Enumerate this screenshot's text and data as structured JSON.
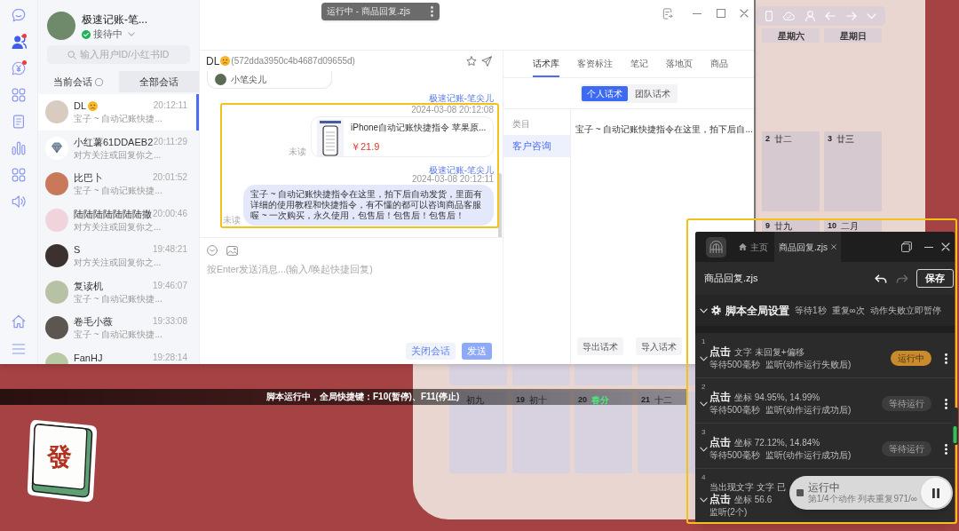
{
  "top_pill": {
    "title": "运行中 - 商品回复.zjs"
  },
  "chat_window": {
    "nav": [
      {
        "kind": "chat",
        "selected": false,
        "badge": false
      },
      {
        "kind": "customers",
        "selected": true,
        "badge": true
      },
      {
        "kind": "yen_chat",
        "selected": false,
        "badge": true
      },
      {
        "kind": "apps",
        "selected": false,
        "badge": false
      },
      {
        "kind": "document",
        "selected": false,
        "badge": false
      },
      {
        "kind": "stats",
        "selected": false,
        "badge": false
      },
      {
        "kind": "apps",
        "selected": false,
        "badge": false
      },
      {
        "kind": "sound",
        "selected": false,
        "badge": false
      }
    ],
    "nav_bottom": [
      {
        "kind": "home"
      },
      {
        "kind": "menu"
      }
    ],
    "account": {
      "name": "极速记账-笔...",
      "status": "接待中",
      "online": true
    },
    "search": {
      "placeholder": "输入用户ID/小红书ID"
    },
    "session_tabs": [
      {
        "label": "当前会话",
        "selected": true,
        "ring": true
      },
      {
        "label": "全部会话",
        "selected": false,
        "ring": false
      }
    ],
    "conversations": [
      {
        "name": "DL",
        "emoji": true,
        "avatar": {
          "kind": "photo"
        },
        "preview": "宝子 ~ 自动记账快捷...",
        "time": "20:12:11",
        "selected": true
      },
      {
        "name": "小红薯61DDAEB2",
        "emoji": false,
        "avatar": {
          "kind": "diamond"
        },
        "preview": "对方关注或回复你之...",
        "time": "20:11:29",
        "selected": false
      },
      {
        "name": "比巴卜",
        "emoji": false,
        "avatar": {
          "kind": "photo"
        },
        "preview": "宝子 ~ 自动记账快捷...",
        "time": "20:01:52",
        "selected": false
      },
      {
        "name": "陆陆陆陆陆陆陆撒",
        "emoji": false,
        "avatar": {
          "kind": "photo"
        },
        "preview": "对方关注或回复你之...",
        "time": "20:00:46",
        "selected": false
      },
      {
        "name": "S",
        "emoji": false,
        "avatar": {
          "kind": "photo"
        },
        "preview": "对方关注或回复你之...",
        "time": "19:48:21",
        "selected": false
      },
      {
        "name": "复读机",
        "emoji": false,
        "avatar": {
          "kind": "photo"
        },
        "preview": "宝子 ~ 自动记账快捷...",
        "time": "19:46:07",
        "selected": false
      },
      {
        "name": "卷毛小薇",
        "emoji": false,
        "avatar": {
          "kind": "photo"
        },
        "preview": "宝子 ~ 自动记账快捷...",
        "time": "19:33:08",
        "selected": false
      },
      {
        "name": "FanHJ",
        "emoji": false,
        "avatar": {
          "kind": "photo"
        },
        "time": "19:28:14",
        "selected": false
      }
    ],
    "chat": {
      "contact": "DL",
      "emoji": true,
      "contact_id": "(572dda3950c4b4687d09655d)",
      "messages": [
        {
          "kind": "card_tail",
          "name": "小笔尖儿"
        },
        {
          "kind": "product",
          "sender": "极速记账-笔尖儿",
          "time": "2024-03-08 20:12:08",
          "title": "iPhone自动记账快捷指令 苹果原...",
          "price": "￥21.9",
          "status": "未读"
        },
        {
          "kind": "text",
          "sender": "极速记账-笔尖儿",
          "time": "2024-03-08 20:12:11",
          "text": "宝子 ~ 自动记账快捷指令在这里，拍下后自动发货，里面有详细的使用教程和快捷指令，有不懂的都可以咨询商品客服喔 ~ 一次购买，永久使用，包售后！包售后！包售后！",
          "status": "未读"
        }
      ],
      "input": {
        "placeholder": "按Enter发送消息...(输入/唤起快捷回复)"
      },
      "buttons": [
        {
          "label": "关闭会话",
          "kind": "secondary",
          "disabled": false
        },
        {
          "label": "发送",
          "kind": "primary",
          "disabled": true
        }
      ]
    },
    "side_panel": {
      "tabs": [
        {
          "label": "话术库",
          "selected": true
        },
        {
          "label": "客资标注",
          "selected": false
        },
        {
          "label": "笔记",
          "selected": false
        },
        {
          "label": "落地页",
          "selected": false
        },
        {
          "label": "商品",
          "selected": false
        }
      ],
      "scopes": [
        {
          "label": "个人话术",
          "selected": true
        },
        {
          "label": "团队话术",
          "selected": false
        }
      ],
      "category_header": "类目",
      "categories": [
        {
          "label": "客户咨询",
          "selected": true
        }
      ],
      "scripts": [
        "宝子 ~ 自动记账快捷指令在这里，拍下后自..."
      ],
      "buttons": [
        "导出话术",
        "导入话术"
      ]
    }
  },
  "status_bar": {
    "text": "脚本运行中，全局快捷键：F10(暂停)、F11(停止)"
  },
  "calendar": {
    "weekdays": [
      "星期六",
      "星期日"
    ],
    "cells": [
      {
        "day": "2",
        "lunar": "廿二"
      },
      {
        "day": "3",
        "lunar": "廿三"
      },
      {
        "day": "9",
        "lunar": "廿九"
      },
      {
        "day": "10",
        "lunar": "二月"
      }
    ],
    "last_row": [
      {
        "lunar": "初九",
        "solar_term": false
      },
      {
        "day": "19",
        "lunar": "初十",
        "solar_term": false
      },
      {
        "day": "20",
        "lunar": "春分",
        "solar_term": true
      },
      {
        "day": "21",
        "lunar": "十二",
        "solar_term": false
      }
    ]
  },
  "sticker": {
    "glyph": "發"
  },
  "script_window": {
    "tabs": [
      {
        "kind": "home",
        "label": "主页",
        "selected": false
      },
      {
        "kind": "file",
        "label": "商品回复.zjs",
        "selected": true
      }
    ],
    "file_name": "商品回复.zjs",
    "can_undo": true,
    "can_redo": false,
    "save": "保存",
    "global": {
      "title": "脚本全局设置",
      "settings": [
        "等待1秒",
        "重复∞次",
        "动作失败立即暂停"
      ]
    },
    "actions": [
      {
        "index": "1",
        "action": "点击",
        "target": "文字 未回复+偏移",
        "details": [
          "等待500毫秒",
          "监听(动作运行失败后)"
        ],
        "status": {
          "label": "运行中",
          "kind": "running"
        }
      },
      {
        "index": "2",
        "action": "点击",
        "target": "坐标 94.95%, 14.99%",
        "details": [
          "等待500毫秒",
          "监听(动作运行成功后)"
        ],
        "status": {
          "label": "等待运行",
          "kind": "waiting"
        }
      },
      {
        "index": "3",
        "action": "点击",
        "target": "坐标 72.12%, 14.84%",
        "details": [
          "等待500毫秒",
          "监听(动作运行成功后)"
        ],
        "status": {
          "label": "等待运行",
          "kind": "waiting"
        }
      },
      {
        "index": "4",
        "condition": "当出现文字 文字 已",
        "action": "点击",
        "target": "坐标 56.6",
        "details": [
          "监听(2个)"
        ]
      }
    ],
    "run_status": {
      "title": "运行中",
      "detail": "第1/4个动作 列表重复971/∞"
    }
  }
}
